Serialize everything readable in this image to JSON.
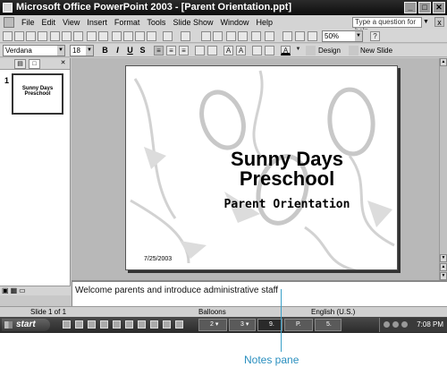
{
  "window": {
    "title": "Microsoft Office PowerPoint 2003 - [Parent Orientation.ppt]",
    "min": "_",
    "max": "□",
    "close": "✕"
  },
  "menu": {
    "items": [
      "File",
      "Edit",
      "View",
      "Insert",
      "Format",
      "Tools",
      "Slide Show",
      "Window",
      "Help"
    ],
    "help_placeholder": "Type a question for help",
    "close": "x"
  },
  "toolbar": {
    "zoom": "50%",
    "font": "Verdana",
    "size": "18",
    "bold": "B",
    "italic": "I",
    "underline": "U",
    "shadow": "S",
    "design_label": "Design",
    "new_slide_label": "New Slide"
  },
  "outline": {
    "slide_number": "1",
    "thumb_title": "Sunny Days Preschool"
  },
  "slide": {
    "title_line1": "Sunny Days",
    "title_line2": "Preschool",
    "subtitle": "Parent Orientation",
    "date": "7/25/2003"
  },
  "notes": {
    "text": "Welcome parents and introduce administrative staff"
  },
  "status": {
    "slide": "Slide 1 of 1",
    "design": "Balloons",
    "language": "English (U.S.)"
  },
  "taskbar": {
    "start": "start",
    "clock": "7:08 PM",
    "tasks": [
      "2 ▾",
      "3 ▾",
      "9.",
      "P.",
      "5."
    ]
  },
  "callout": {
    "label": "Notes pane"
  }
}
